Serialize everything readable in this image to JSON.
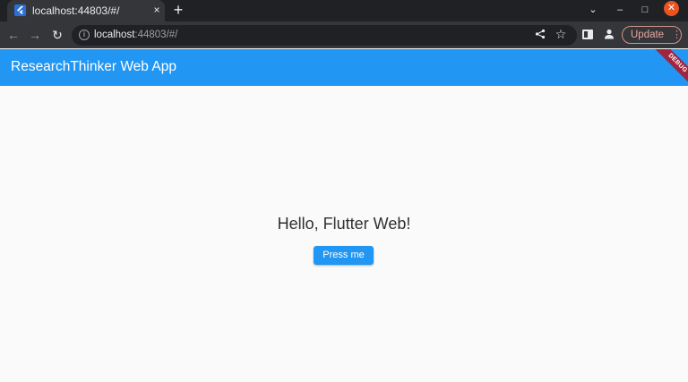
{
  "browser": {
    "tab_title": "localhost:44803/#/",
    "tab_close_glyph": "×",
    "new_tab_glyph": "+",
    "url_host": "localhost",
    "url_rest": ":44803/#/",
    "update_label": "Update",
    "nav_back_glyph": "←",
    "nav_forward_glyph": "→",
    "reload_glyph": "↻",
    "tab_search_glyph": "⌄",
    "minimize_glyph": "–",
    "maximize_glyph": "□",
    "close_glyph": "✕",
    "menu_glyph": "⋮",
    "icons": [
      "flutter-favicon",
      "info-icon",
      "share-icon",
      "star-icon",
      "side-panel-icon",
      "profile-icon"
    ]
  },
  "app": {
    "title": "ResearchThinker Web App",
    "debug_banner": "DEBUG",
    "greeting": "Hello, Flutter Web!",
    "button_label": "Press me"
  },
  "colors": {
    "app_bar": "#2196f3",
    "button": "#2196f3",
    "debug_banner": "#a0253f",
    "window_close": "#e95420",
    "page_background": "#fafafa"
  }
}
